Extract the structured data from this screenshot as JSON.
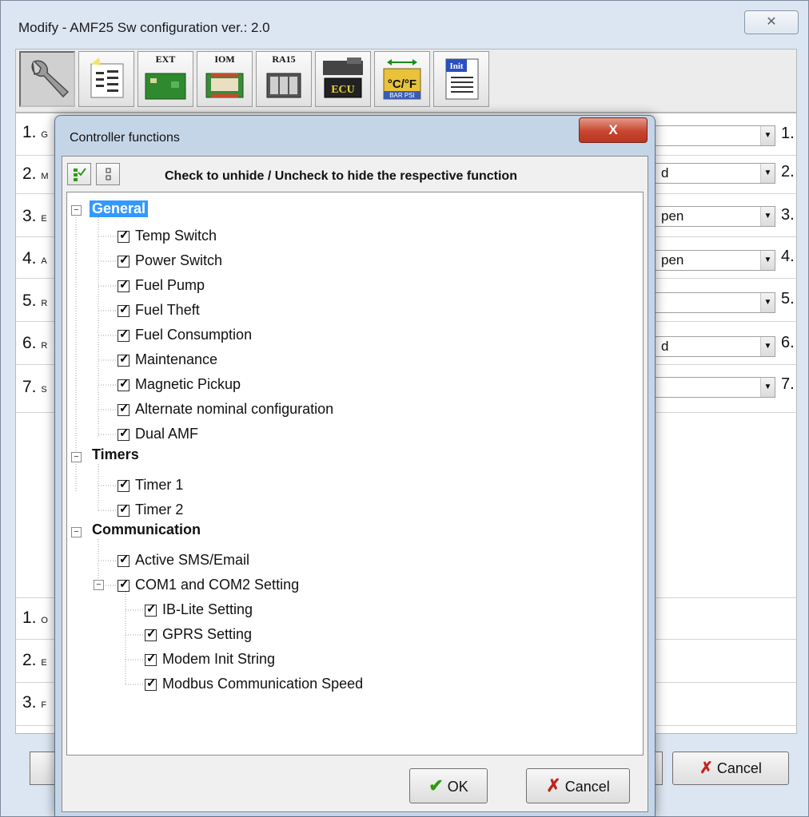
{
  "window": {
    "title": "Modify - AMF25  Sw configuration ver.: 2.0",
    "close_glyph": "✕",
    "cancel_label": "Cancel"
  },
  "toolbar": {
    "buttons": [
      {
        "label": "",
        "icon": "wrench-icon"
      },
      {
        "label": "",
        "icon": "list-icon"
      },
      {
        "label": "EXT",
        "icon": "ext-module-icon"
      },
      {
        "label": "IOM",
        "icon": "iom-module-icon"
      },
      {
        "label": "RA15",
        "icon": "ra15-module-icon"
      },
      {
        "label": "ECU",
        "icon": "ecu-icon"
      },
      {
        "label": "°C/°F",
        "icon": "units-icon"
      },
      {
        "label": "Init",
        "icon": "init-icon"
      }
    ]
  },
  "background_rows": {
    "top": [
      {
        "num": "1.",
        "letter": "G",
        "combo": "",
        "right": "1."
      },
      {
        "num": "2.",
        "letter": "M",
        "combo": "d",
        "right": "2."
      },
      {
        "num": "3.",
        "letter": "E",
        "combo": "pen",
        "right": "3."
      },
      {
        "num": "4.",
        "letter": "A",
        "combo": "pen",
        "right": "4."
      },
      {
        "num": "5.",
        "letter": "R",
        "combo": "",
        "right": "5."
      },
      {
        "num": "6.",
        "letter": "R",
        "combo": "d",
        "right": "6."
      },
      {
        "num": "7.",
        "letter": "S",
        "combo": "",
        "right": "7."
      }
    ],
    "bottom": [
      {
        "num": "1.",
        "letter": "O"
      },
      {
        "num": "2.",
        "letter": "E"
      },
      {
        "num": "3.",
        "letter": "F"
      }
    ]
  },
  "dialog": {
    "title": "Controller functions",
    "close_glyph": "X",
    "header": "Check to unhide / Uncheck to hide the respective function",
    "ok_label": "OK",
    "cancel_label": "Cancel",
    "check_mark": "✓",
    "groups": [
      {
        "label": "General",
        "selected": true,
        "items": [
          "Temp Switch",
          "Power Switch",
          "Fuel Pump",
          "Fuel Theft",
          "Fuel Consumption",
          "Maintenance",
          "Magnetic Pickup",
          "Alternate nominal configuration",
          "Dual AMF"
        ]
      },
      {
        "label": "Timers",
        "selected": false,
        "items": [
          "Timer 1",
          "Timer 2"
        ]
      },
      {
        "label": "Communication",
        "selected": false,
        "items": [
          "Active SMS/Email"
        ],
        "subgroup": {
          "label": "COM1 and COM2 Setting",
          "items": [
            "IB-Lite Setting",
            "GPRS Setting",
            "Modem Init String",
            "Modbus Communication Speed"
          ]
        }
      }
    ]
  },
  "colors": {
    "selection": "#3399ff",
    "check_icon": "#2f9a12",
    "cancel_icon": "#c0241b"
  }
}
